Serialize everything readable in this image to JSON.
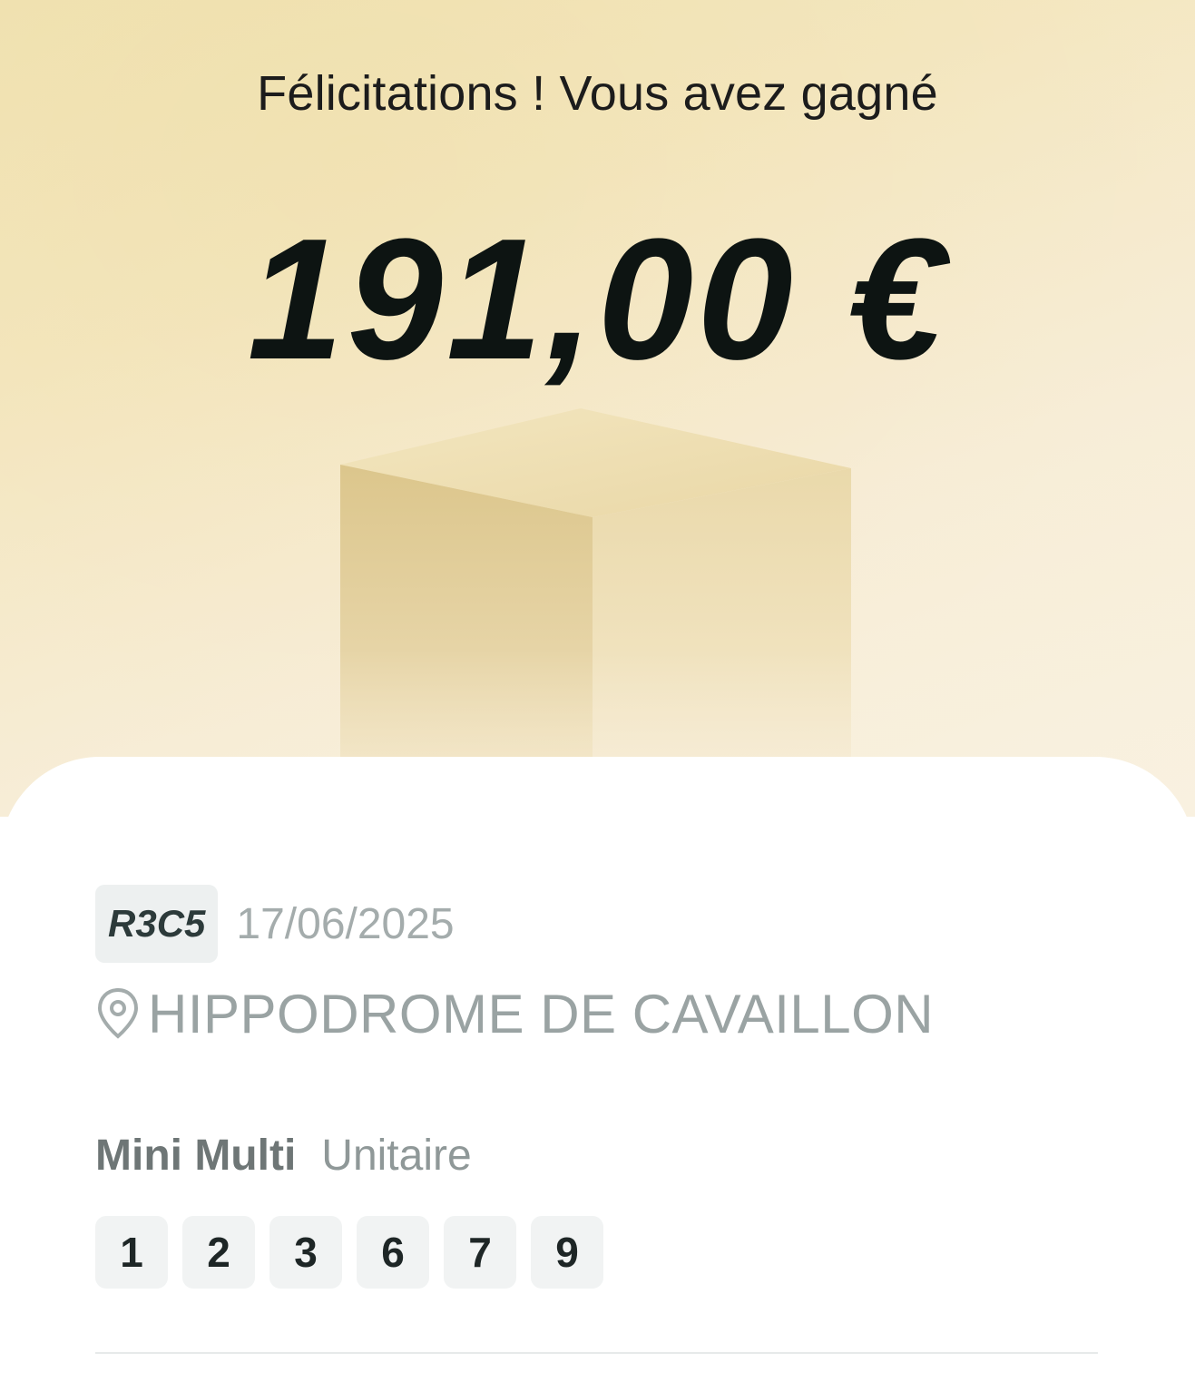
{
  "hero": {
    "headline": "Félicitations ! Vous avez gagné",
    "amount": "191,00 €",
    "colors": {
      "background_start": "#efdfaa",
      "background_end": "#f8efdb",
      "amount_text": "#0d1412"
    }
  },
  "race": {
    "code": "R3C5",
    "date": "17/06/2025",
    "venue_icon": "location-pin-icon",
    "venue": "HIPPODROME DE CAVAILLON"
  },
  "bet": {
    "type": "Mini Multi",
    "mode": "Unitaire",
    "numbers": [
      "1",
      "2",
      "3",
      "6",
      "7",
      "9"
    ]
  }
}
